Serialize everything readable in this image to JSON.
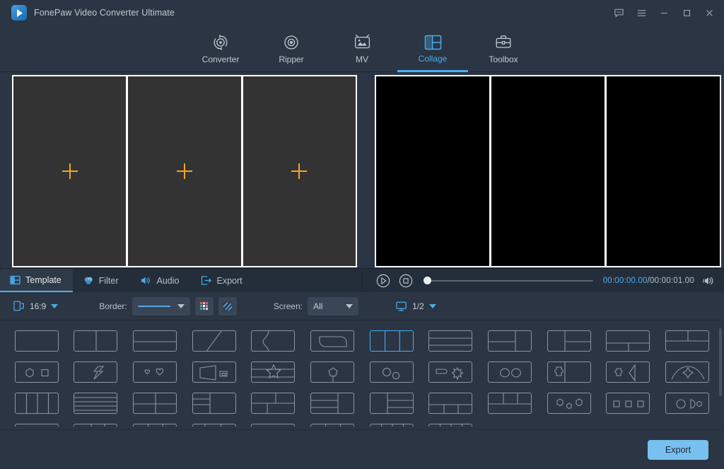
{
  "window": {
    "title": "FonePaw Video Converter Ultimate",
    "logo_icon": "play-logo-icon",
    "controls": [
      {
        "name": "feedback-icon",
        "label": "Feedback"
      },
      {
        "name": "menu-icon",
        "label": "Menu"
      },
      {
        "name": "minimize-icon",
        "label": "Minimize"
      },
      {
        "name": "maximize-icon",
        "label": "Maximize"
      },
      {
        "name": "close-icon",
        "label": "Close"
      }
    ]
  },
  "nav": {
    "active": "Collage",
    "tabs": [
      {
        "label": "Converter",
        "icon": "converter-icon"
      },
      {
        "label": "Ripper",
        "icon": "disc-icon"
      },
      {
        "label": "MV",
        "icon": "tv-image-icon"
      },
      {
        "label": "Collage",
        "icon": "collage-grid-icon"
      },
      {
        "label": "Toolbox",
        "icon": "toolbox-icon"
      }
    ]
  },
  "editor": {
    "canvas": {
      "cells": [
        {
          "state": "empty",
          "add_icon": "plus-icon"
        },
        {
          "state": "empty",
          "add_icon": "plus-icon"
        },
        {
          "state": "empty",
          "add_icon": "plus-icon"
        }
      ]
    },
    "preview": {
      "cells": [
        {
          "state": "filled"
        },
        {
          "state": "filled"
        },
        {
          "state": "filled"
        }
      ]
    }
  },
  "edit_tabs": {
    "active": "Template",
    "items": [
      {
        "label": "Template",
        "icon": "template-icon"
      },
      {
        "label": "Filter",
        "icon": "filter-drops-icon"
      },
      {
        "label": "Audio",
        "icon": "speaker-icon"
      },
      {
        "label": "Export",
        "icon": "export-arrow-icon"
      }
    ]
  },
  "player": {
    "play_icon": "play-circle-icon",
    "stop_icon": "stop-circle-icon",
    "volume_icon": "volume-icon",
    "current_time": "00:00:00.00",
    "separator": "/",
    "total_time": "00:00:01.00",
    "progress_percent": 0
  },
  "options": {
    "aspect_icon": "aspect-ratio-icon",
    "aspect_ratio": "16:9",
    "border_label": "Border:",
    "border_style": "solid-line",
    "border_color_icon": "color-palette-icon",
    "border_pattern_icon": "stripe-pattern-icon",
    "screen_label": "Screen:",
    "screen_value": "All",
    "monitor_icon": "monitor-icon",
    "page_indicator": "1/2"
  },
  "templates": {
    "selected_index": 6,
    "items": [
      {
        "name": "single-pane",
        "layout": "single"
      },
      {
        "name": "two-column",
        "layout": "cols2"
      },
      {
        "name": "two-row",
        "layout": "rows2"
      },
      {
        "name": "diagonal-split",
        "layout": "diagonal"
      },
      {
        "name": "curved-split",
        "layout": "curve"
      },
      {
        "name": "rounded-shape",
        "layout": "rounded"
      },
      {
        "name": "three-column",
        "layout": "cols3"
      },
      {
        "name": "three-row",
        "layout": "rows3"
      },
      {
        "name": "left-stack-right-pane",
        "layout": "stackleft"
      },
      {
        "name": "right-stack-left-pane",
        "layout": "stackright"
      },
      {
        "name": "top-wide-bottom-two",
        "layout": "topwide"
      },
      {
        "name": "bottom-wide-top-two",
        "layout": "botwide"
      },
      {
        "name": "hexagon-square",
        "layout": "hexsq"
      },
      {
        "name": "lightning-shape",
        "layout": "bolt"
      },
      {
        "name": "two-hearts",
        "layout": "hearts"
      },
      {
        "name": "trapezoid-pair",
        "layout": "trapezoid"
      },
      {
        "name": "star-band",
        "layout": "star"
      },
      {
        "name": "pentagon-center",
        "layout": "pentagon"
      },
      {
        "name": "two-circles-gear",
        "layout": "circles2"
      },
      {
        "name": "flag-sunburst",
        "layout": "sunburst"
      },
      {
        "name": "double-oval",
        "layout": "ovals"
      },
      {
        "name": "puzzle-shape",
        "layout": "puzzle"
      },
      {
        "name": "puzzle-arrow",
        "layout": "puzzlearrow"
      },
      {
        "name": "arc-diamond",
        "layout": "arcdiamond"
      },
      {
        "name": "four-column",
        "layout": "cols4"
      },
      {
        "name": "five-row",
        "layout": "rows5"
      },
      {
        "name": "two-by-two",
        "layout": "grid22"
      },
      {
        "name": "left-split-right-pane",
        "layout": "lsplit"
      },
      {
        "name": "top-two-bottom-wide",
        "layout": "mix1"
      },
      {
        "name": "left-rows-right-pane",
        "layout": "mix2"
      },
      {
        "name": "left-pane-right-rows",
        "layout": "mix3"
      },
      {
        "name": "top-wide-bottom-three",
        "layout": "mix4"
      },
      {
        "name": "top-three-bottom-wide",
        "layout": "mix5"
      },
      {
        "name": "three-hexagons",
        "layout": "hex3"
      },
      {
        "name": "three-squares",
        "layout": "sq3"
      },
      {
        "name": "circle-pac-circle",
        "layout": "pac"
      },
      {
        "name": "triple-arrow",
        "layout": "arrows"
      },
      {
        "name": "two-plus-grid",
        "layout": "mix6"
      },
      {
        "name": "grid-2x3",
        "layout": "grid23"
      },
      {
        "name": "left-pane-grid4",
        "layout": "mix7"
      },
      {
        "name": "bubbles",
        "layout": "bubbles"
      },
      {
        "name": "grid-3x2",
        "layout": "grid32"
      },
      {
        "name": "four-cell-row",
        "layout": "cols4b"
      },
      {
        "name": "four-cell-row-alt",
        "layout": "cols4c"
      }
    ]
  },
  "footer": {
    "export_label": "Export"
  }
}
